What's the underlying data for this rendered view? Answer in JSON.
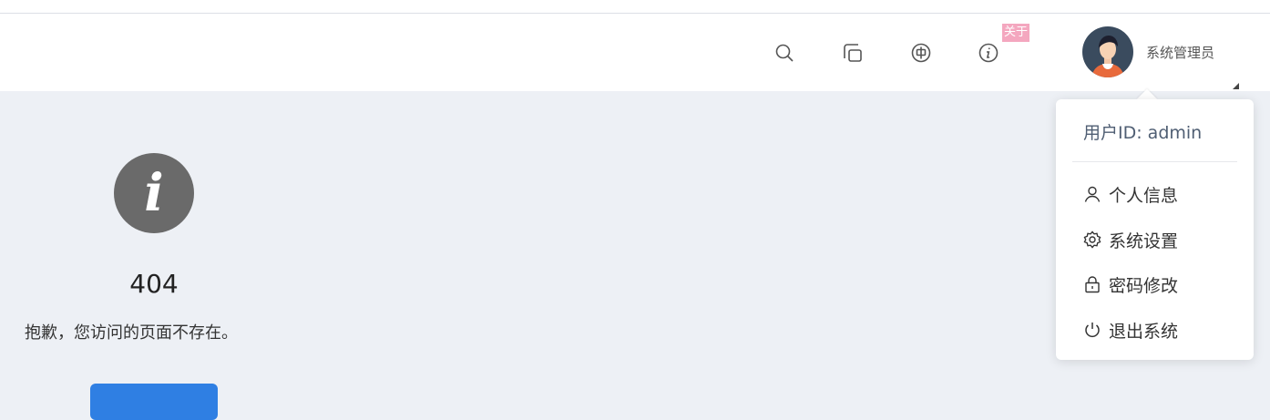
{
  "header": {
    "badge_label": "关于",
    "icons": [
      "search-icon",
      "fullscreen-icon",
      "language-icon",
      "info-icon"
    ],
    "user_name": "系统管理员"
  },
  "error": {
    "code": "404",
    "message": "抱歉，您访问的页面不存在。",
    "back_button_label": ""
  },
  "dropdown": {
    "user_id_label": "用户ID: admin",
    "items": [
      {
        "label": "个人信息",
        "icon": "user-icon"
      },
      {
        "label": "系统设置",
        "icon": "gear-icon"
      },
      {
        "label": "密码修改",
        "icon": "lock-icon"
      },
      {
        "label": "退出系统",
        "icon": "power-icon"
      }
    ]
  },
  "colors": {
    "background": "#edf0f5",
    "badge": "#f4a7bf",
    "primary_button": "#2f7fe3",
    "info_circle": "#6a6a6a"
  }
}
